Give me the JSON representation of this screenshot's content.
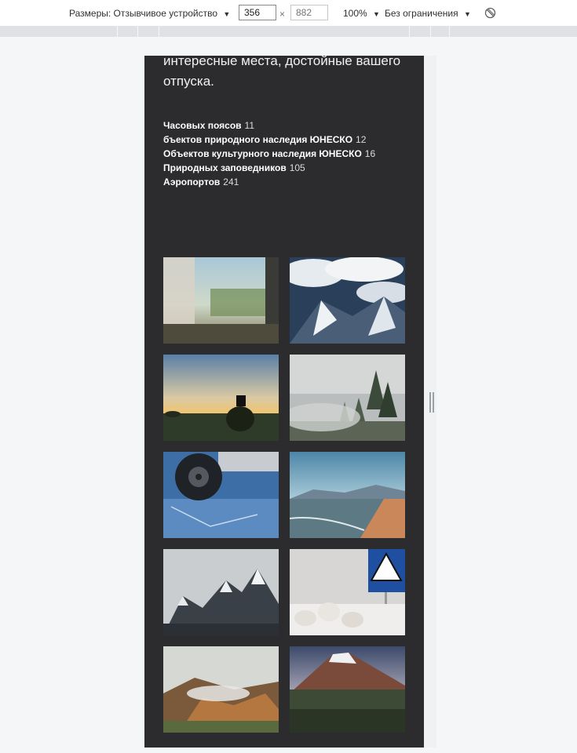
{
  "devtools": {
    "dimensions_label": "Размеры: Отзывчивое устройство",
    "width_value": "356",
    "height_placeholder": "882",
    "zoom": "100%",
    "throttle": "Без ограничения",
    "dropdown_glyph": "▼",
    "times_glyph": "×",
    "rotate_icon": "rotate-icon"
  },
  "page": {
    "intro_text": "интересные места, достойные вашего отпуска.",
    "stats": [
      {
        "label": "Часовых поясов",
        "value": "11"
      },
      {
        "label": "бъектов природного наследия ЮНЕСКО",
        "value": "12"
      },
      {
        "label": "Объектов культурного наследия ЮНЕСКО",
        "value": "16"
      },
      {
        "label": "Природных заповедников",
        "value": "105"
      },
      {
        "label": "Аэропортов",
        "value": "241"
      }
    ],
    "gallery": [
      "train-window-photo",
      "snowy-mountains-aerial-photo",
      "sunset-dog-silhouette-photo",
      "foggy-forest-photo",
      "car-on-ice-photo",
      "lake-shore-photo",
      "snow-mountain-peaks-photo",
      "pedestrian-sign-photo",
      "misty-volcanic-hills-photo",
      "volcano-photo"
    ]
  },
  "colors": {
    "page_background": "#2c2c2f",
    "devtools_background": "#ffffff",
    "outer_background": "#f5f6f7"
  }
}
